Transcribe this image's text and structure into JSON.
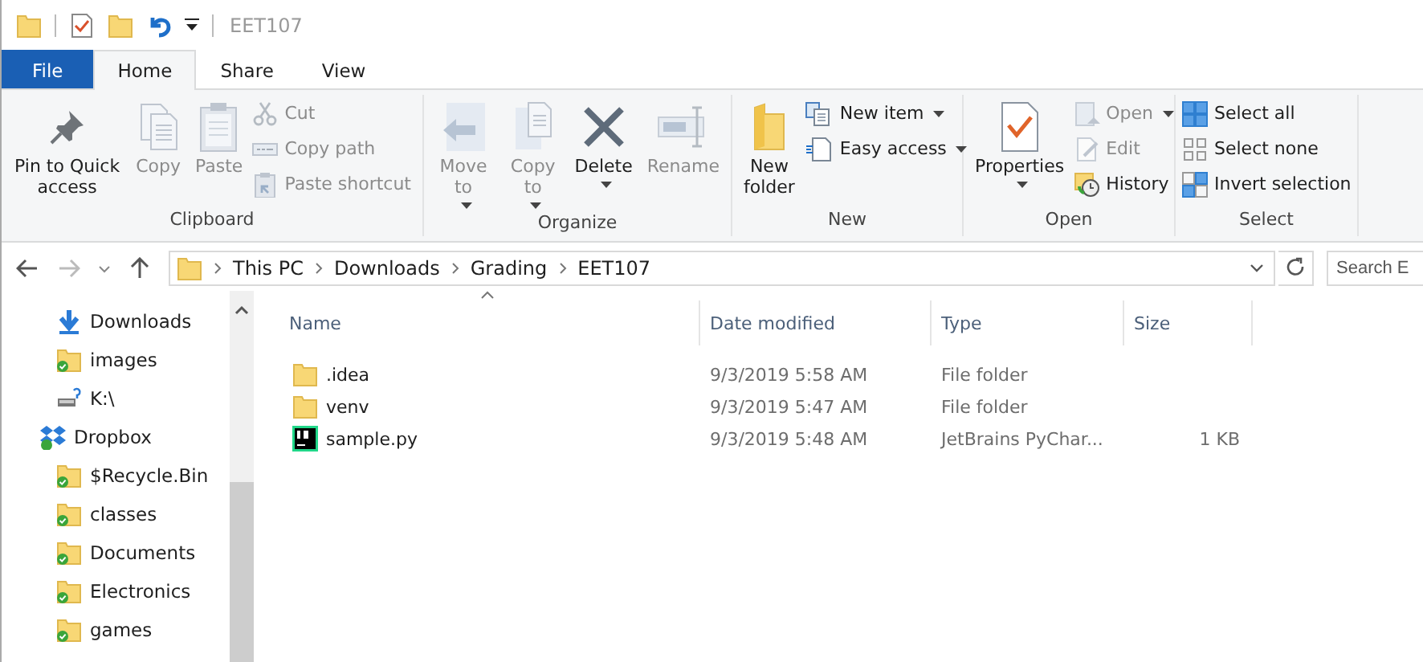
{
  "window": {
    "title": "EET107"
  },
  "tabs": [
    {
      "label": "File",
      "kind": "file",
      "selected": false
    },
    {
      "label": "Home",
      "kind": "tab",
      "selected": true
    },
    {
      "label": "Share",
      "kind": "tab",
      "selected": false
    },
    {
      "label": "View",
      "kind": "tab",
      "selected": false
    }
  ],
  "ribbon": {
    "groups": [
      {
        "label": "Clipboard",
        "items": [
          {
            "label": "Pin to Quick access",
            "kind": "large",
            "disabled": false,
            "dropdown": false
          },
          {
            "label": "Copy",
            "kind": "large",
            "disabled": true,
            "dropdown": false
          },
          {
            "label": "Paste",
            "kind": "large",
            "disabled": true,
            "dropdown": false
          },
          {
            "label": "Cut",
            "kind": "small",
            "disabled": true,
            "dropdown": false
          },
          {
            "label": "Copy path",
            "kind": "small",
            "disabled": true,
            "dropdown": false
          },
          {
            "label": "Paste shortcut",
            "kind": "small",
            "disabled": true,
            "dropdown": false
          }
        ]
      },
      {
        "label": "Organize",
        "items": [
          {
            "label": "Move to",
            "kind": "large",
            "disabled": true,
            "dropdown": true
          },
          {
            "label": "Copy to",
            "kind": "large",
            "disabled": true,
            "dropdown": true
          },
          {
            "label": "Delete",
            "kind": "large",
            "disabled": false,
            "dropdown": true
          },
          {
            "label": "Rename",
            "kind": "large",
            "disabled": true,
            "dropdown": false
          }
        ]
      },
      {
        "label": "New",
        "items": [
          {
            "label": "New folder",
            "kind": "large",
            "disabled": false,
            "dropdown": false
          },
          {
            "label": "New item",
            "kind": "small",
            "disabled": false,
            "dropdown": true
          },
          {
            "label": "Easy access",
            "kind": "small",
            "disabled": false,
            "dropdown": true
          }
        ]
      },
      {
        "label": "Open",
        "items": [
          {
            "label": "Properties",
            "kind": "large",
            "disabled": false,
            "dropdown": true
          },
          {
            "label": "Open",
            "kind": "small",
            "disabled": true,
            "dropdown": true
          },
          {
            "label": "Edit",
            "kind": "small",
            "disabled": true,
            "dropdown": false
          },
          {
            "label": "History",
            "kind": "small",
            "disabled": false,
            "dropdown": false
          }
        ]
      },
      {
        "label": "Select",
        "items": [
          {
            "label": "Select all",
            "kind": "small",
            "disabled": false,
            "dropdown": false
          },
          {
            "label": "Select none",
            "kind": "small",
            "disabled": false,
            "dropdown": false
          },
          {
            "label": "Invert selection",
            "kind": "small",
            "disabled": false,
            "dropdown": false
          }
        ]
      }
    ]
  },
  "address": {
    "crumbs": [
      "This PC",
      "Downloads",
      "Grading",
      "EET107"
    ],
    "search_placeholder": "Search E"
  },
  "nav": {
    "items": [
      {
        "label": "Downloads",
        "kind": "download"
      },
      {
        "label": "images",
        "kind": "synced-folder"
      },
      {
        "label": "K:\\",
        "kind": "drive"
      },
      {
        "label": "Dropbox",
        "kind": "dropbox",
        "children": [
          {
            "label": "$Recycle.Bin",
            "kind": "synced-folder"
          },
          {
            "label": "classes",
            "kind": "synced-folder"
          },
          {
            "label": "Documents",
            "kind": "synced-folder"
          },
          {
            "label": "Electronics",
            "kind": "synced-folder"
          },
          {
            "label": "games",
            "kind": "synced-folder"
          }
        ]
      }
    ]
  },
  "files": {
    "columns": [
      "Name",
      "Date modified",
      "Type",
      "Size"
    ],
    "rows": [
      {
        "name": ".idea",
        "date": "9/3/2019 5:58 AM",
        "type": "File folder",
        "kind": "folder"
      },
      {
        "name": "venv",
        "date": "9/3/2019 5:47 AM",
        "type": "File folder",
        "kind": "folder"
      },
      {
        "name": "sample.py",
        "date": "9/3/2019 5:48 AM",
        "type": "JetBrains PyChar...",
        "size": "1 KB",
        "kind": "pycharm"
      }
    ]
  }
}
